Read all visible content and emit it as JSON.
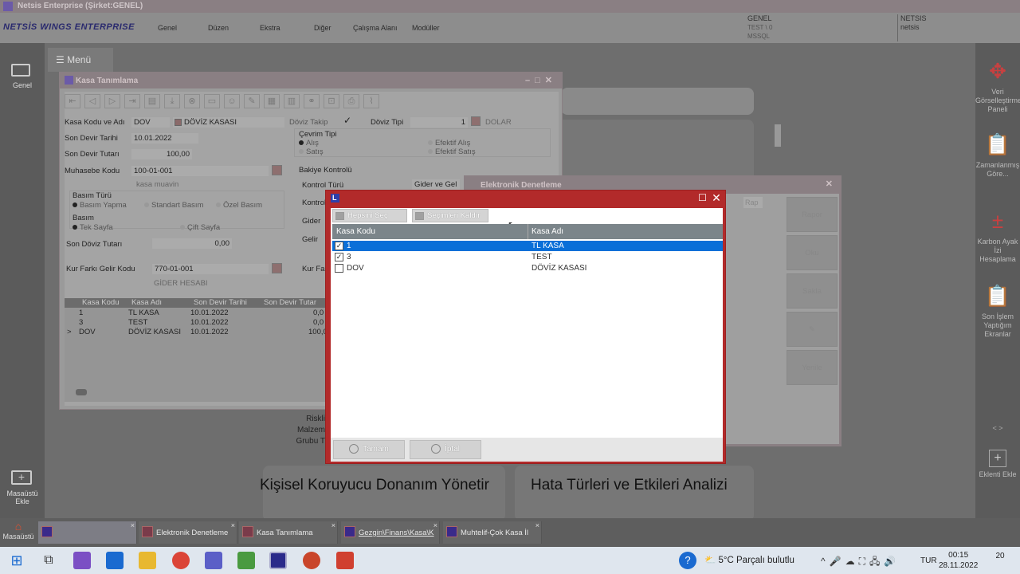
{
  "app": {
    "title": "Netsis Enterprise (Şirket:GENEL)",
    "brand": "NETSİS WINGS ENTERPRISE",
    "menu": [
      "Genel",
      "Düzen",
      "Ekstra",
      "Diğer",
      "Çalışma Alanı",
      "Modüller"
    ],
    "info_company": "GENEL",
    "info_db": "TEST \\ 0",
    "info_server": "MSSQL",
    "info_user": "NETSIS",
    "info_user2": "netsis"
  },
  "left_sidebar": {
    "genel_label": "Genel",
    "menu_button": "Menü",
    "desktop_add": "Masaüstü Ekle"
  },
  "right_sidebar": {
    "items": [
      "Veri Görselleştirme Paneli",
      "Zamanlanmış Göre...",
      "Karbon Ayak İzi Hesaplama",
      "Son İşlem Yaptığım Ekranlar"
    ],
    "add_label": "Eklenti Ekle",
    "nav": "<   >"
  },
  "dashboard": {
    "card1_title": "Kişisel Koruyucu Donanım Yönetir",
    "card2_title": "Hata Türleri ve Etkileri Analizi",
    "risk_labels": [
      "Riskli",
      "Malzem",
      "Grubu T"
    ]
  },
  "kasa_window": {
    "title": "Kasa Tanımlama",
    "kasa_kodu_label": "Kasa Kodu ve Adı",
    "kasa_kodu": "DOV",
    "kasa_adi": "DÖVİZ KASASI",
    "doviz_takip_label": "Döviz Takip",
    "doviz_tipi_label": "Döviz Tipi",
    "doviz_tipi_value": "1",
    "doviz_name": "DOLAR",
    "son_devir_tarihi_label": "Son Devir Tarihi",
    "son_devir_tarihi": "10.01.2022",
    "son_devir_tutari_label": "Son Devir Tutarı",
    "son_devir_tutari": "100,00",
    "muhasebe_kodu_label": "Muhasebe Kodu",
    "muhasebe_kodu": "100-01-001",
    "muhasebe_desc": "kasa muavin",
    "cevrim_tipi_label": "Çevrim Tipi",
    "cevrim_options": [
      "Alış",
      "Satış",
      "Efektif Alış",
      "Efektif Satış"
    ],
    "basim_turu_label": "Basım Türü",
    "basim_options": [
      "Basım Yapma",
      "Standart Basım",
      "Özel Basım"
    ],
    "basim_label": "Basım",
    "sayfa_options": [
      "Tek Sayfa",
      "Çift Sayfa"
    ],
    "son_doviz_tutari_label": "Son Döviz Tutarı",
    "son_doviz_tutari": "0,00",
    "bakiye_kontrolu_label": "Bakiye Kontrolü",
    "kontrol_turu_label": "Kontrol Türü",
    "kontrol_turu_value": "Gider ve Gel",
    "kontrol_label": "Kontrol",
    "gider_label": "Gider",
    "gelir_label": "Gelir",
    "kur_farki_label": "Kur Farkı Gelir Kodu",
    "kur_farki_kodu": "770-01-001",
    "kur_farki_desc": "GİDER HESABI",
    "kur_fa_label": "Kur Fa",
    "grid_headers": [
      "Kasa Kodu",
      "Kasa Adı",
      "Son Devir Tarihi",
      "Son Devir Tutar"
    ],
    "grid_rows": [
      {
        "kod": "1",
        "ad": "TL KASA",
        "tarih": "10.01.2022",
        "tutar": "0,0"
      },
      {
        "kod": "3",
        "ad": "TEST",
        "tarih": "10.01.2022",
        "tutar": "0,0"
      },
      {
        "kod": "DOV",
        "ad": "DÖVİZ KASASI",
        "tarih": "10.01.2022",
        "tutar": "100,0",
        "marker": ">"
      }
    ]
  },
  "ed_window": {
    "title": "Elektronik Denetleme",
    "tab_label": "Rap",
    "buttons": [
      "Rapor",
      "Oku",
      "Sakla",
      "",
      "Yenile"
    ]
  },
  "dialog": {
    "select_all": "Hepsini Seç",
    "clear_selection": "Seçimleri Kaldır",
    "col_kasa_kodu": "Kasa Kodu",
    "col_kasa_adi": "Kasa Adı",
    "rows": [
      {
        "kod": "1",
        "ad": "TL KASA",
        "checked": true,
        "selected": true
      },
      {
        "kod": "3",
        "ad": "TEST",
        "checked": true,
        "selected": false
      },
      {
        "kod": "DOV",
        "ad": "DÖVİZ KASASI",
        "checked": false,
        "selected": false
      }
    ],
    "ok_label": "Tamam",
    "cancel_label": "İptal"
  },
  "app_tabs": {
    "home": "Masaüstü",
    "tabs": [
      "",
      "Elektronik Denetleme",
      "Kasa Tanımlama",
      "Gezgin\\Finans\\Kasa\\K",
      "Muhtelif-Çok Kasa İl"
    ]
  },
  "taskbar": {
    "weather": "5°C  Parçalı bulutlu",
    "lang": "TUR",
    "time": "00:15",
    "date": "28.11.2022",
    "notifications": "20"
  }
}
